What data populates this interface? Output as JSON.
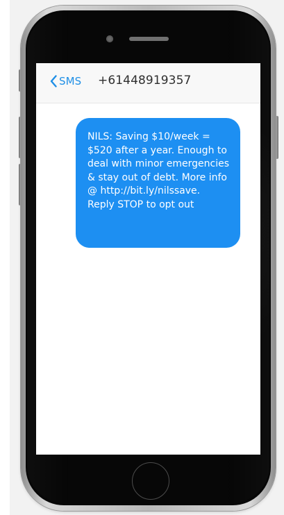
{
  "phone": {
    "frame_color": "#bdbdbd",
    "bezel_color": "#070707",
    "screen_color": "#ffffff"
  },
  "header": {
    "back_icon": "chevron-left-icon",
    "back_label": "SMS",
    "contact": "+61448919357",
    "accent_color": "#1f8fe6"
  },
  "message": {
    "text": "NILS: Saving $10/week = $520 after a year. Enough to deal with minor emergencies & stay out of debt. More info @ http://bit.ly/nilssave. Reply STOP to opt out",
    "bubble_color": "#1d8ff2",
    "text_color": "#ffffff"
  }
}
